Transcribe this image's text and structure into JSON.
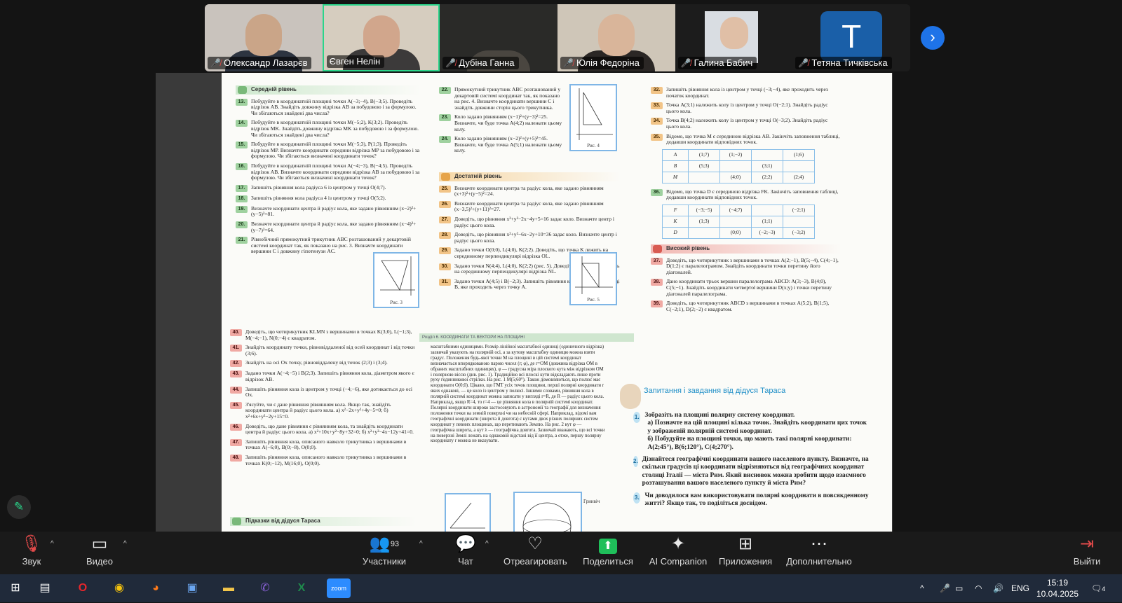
{
  "participants": [
    {
      "name": "Олександр Лазарєв",
      "muted": true
    },
    {
      "name": "Євген Нелін",
      "muted": false
    },
    {
      "name": "Дубіна Ганна",
      "muted": true
    },
    {
      "name": "Юлія Федоріна",
      "muted": true
    },
    {
      "name": "Галина Бабич",
      "muted": true
    },
    {
      "name": "Тетяна Тичківська",
      "muted": true,
      "initial": "T"
    }
  ],
  "doc": {
    "level_mid": "Середній рівень",
    "level_suff": "Достатній рівень",
    "level_high": "Високий рівень",
    "col1": [
      {
        "n": "13.",
        "t": "Побудуйте в координатній площині точки A(−3;−4), B(−3;5). Проведіть відрізок AB. Знайдіть довжину відрізка AB за побудовою і за формулою. Чи збігаються знайдені два числа?"
      },
      {
        "n": "14.",
        "t": "Побудуйте в координатній площині точки M(−5;2), K(3;2). Проведіть відрізок MK. Знайдіть довжину відрізка MK за побудовою і за формулою. Чи збігаються знайдені два числа?"
      },
      {
        "n": "15.",
        "t": "Побудуйте в координатній площині точки M(−5;3), P(1;3). Проведіть відрізок MP. Визначте координати середини відрізка MP за побудовою і за формулою. Чи збігаються визначені координати точок?"
      },
      {
        "n": "16.",
        "t": "Побудуйте в координатній площині точки A(−4;−3), B(−4;5). Проведіть відрізок AB. Визначте координати середини відрізка AB за побудовою і за формулою. Чи збігаються визначені координати точок?"
      },
      {
        "n": "17.",
        "t": "Запишіть рівняння кола радіуса 6 із центром у точці O(4;7)."
      },
      {
        "n": "18.",
        "t": "Запишіть рівняння кола радіуса 4 із центром у точці O(5;2)."
      },
      {
        "n": "19.",
        "t": "Визначте координати центра й радіус кола, яке задано рівнянням (x−2)²+(y−5)²=81."
      },
      {
        "n": "20.",
        "t": "Визначте координати центра й радіус кола, яке задано рівнянням (x−4)²+(y−7)²=64."
      },
      {
        "n": "21.",
        "t": "Рівнобічний прямокутний трикутник ABC розташований у декартовій системі координат так, як показано на рис. 3. Визначте координати вершини C і довжину гіпотенузи AC."
      }
    ],
    "col2": [
      {
        "n": "22.",
        "t": "Прямокутний трикутник ABC розташований у декартовій системі координат так, як показано на рис. 4. Визначте координати вершини C і знайдіть довжини сторін цього трикутника."
      },
      {
        "n": "23.",
        "t": "Коло задано рівнянням (x−1)²+(y−3)²=25. Визначте, чи буде точка A(4;2) належати цьому колу."
      },
      {
        "n": "24.",
        "t": "Коло задано рівнянням (x−2)²+(y+5)²=45. Визначте, чи буде точка A(5;1) належати цьому колу."
      }
    ],
    "col2b": [
      {
        "n": "25.",
        "t": "Визначте координати центра та радіус кола, яке задано рівнянням (x+3)²+(y−5)²=24."
      },
      {
        "n": "26.",
        "t": "Визначте координати центра та радіус кола, яке задано рівнянням (x−3,5)²+(y+11)²=27."
      },
      {
        "n": "27.",
        "t": "Доведіть, що рівняння x²+y²−2x−4y+5=16 задає коло. Визначте центр і радіус цього кола."
      },
      {
        "n": "28.",
        "t": "Доведіть, що рівняння x²+y²−6x−2y+10=36 задає коло. Визначте центр і радіус цього кола."
      },
      {
        "n": "29.",
        "t": "Задано точки O(0;0), L(4;0), K(2;2). Доведіть, що точка K лежить на серединному перпендикулярі відрізка OL."
      },
      {
        "n": "30.",
        "t": "Задано точки N(4;4), L(4;0), K(2;2) (рис. 5). Доведіть, що точка K лежить на серединному перпендикулярі відрізка NL."
      },
      {
        "n": "31.",
        "t": "Задано точки A(4;5) і B(−2;3). Запишіть рівняння кола із центром у точці B, яке проходить через точку A."
      }
    ],
    "col3": [
      {
        "n": "32.",
        "t": "Запишіть рівняння кола із центром у точці (−3;−4), яке проходить через початок координат."
      },
      {
        "n": "33.",
        "t": "Точка A(3;1) належить колу із центром у точці O(−2;1). Знайдіть радіус цього кола."
      },
      {
        "n": "34.",
        "t": "Точка B(4;2) належить колу із центром у точці O(−3;2). Знайдіть радіус цього кола."
      },
      {
        "n": "35.",
        "t": "Відомо, що точка M є серединою відрізка AB. Закінчіть заповнення таблиці, додавши координати відповідних точок."
      }
    ],
    "table35": [
      [
        "A",
        "(1;7)",
        "(1;−2)",
        "",
        "(1;6)"
      ],
      [
        "B",
        "(5;3)",
        "",
        "(3;1)",
        ""
      ],
      [
        "M",
        "",
        "(4;0)",
        "(2;2)",
        "(2;4)"
      ]
    ],
    "task36": {
      "n": "36.",
      "t": "Відомо, що точка D є серединою відрізка FK. Закінчіть заповнення таблиці, додавши координати відповідних точок."
    },
    "table36": [
      [
        "F",
        "(−3;−5)",
        "(−4;7)",
        "",
        "(−2;1)"
      ],
      [
        "K",
        "(1;3)",
        "",
        "(1;1)",
        ""
      ],
      [
        "D",
        "",
        "(0;0)",
        "(−2;−3)",
        "(−3;2)"
      ]
    ],
    "col3b": [
      {
        "n": "37.",
        "t": "Доведіть, що чотирикутник з вершинами в точках A(2;−1), B(5;−4), C(4;−1), D(1;2) є паралелограмом. Знайдіть координати точки перетину його діагоналей."
      },
      {
        "n": "38.",
        "t": "Дано координати трьох вершин паралелограма ABCD: A(3;−3), B(4;0), C(5;−1). Знайдіть координати четвертої вершини D(x;y) і точки перетину діагоналей паралелограма."
      },
      {
        "n": "39.",
        "t": "Доведіть, що чотирикутник ABCD з вершинами в точках A(5;2), B(1;5), C(−2;1), D(2;−2) є квадратом."
      }
    ],
    "col4": [
      {
        "n": "40.",
        "t": "Доведіть, що чотирикутник KLMN з вершинами в точках K(3;0), L(−1;3), M(−4;−1), N(0;−4) є квадратом."
      },
      {
        "n": "41.",
        "t": "Знайдіть координату точки, рівновіддаленої від осей координат і від точки (3;6)."
      },
      {
        "n": "42.",
        "t": "Знайдіть на осі Ox точку, рівновіддалену від точок (2;3) і (3;4)."
      },
      {
        "n": "43.",
        "t": "Задано точки A(−4;−5) і B(2;3). Запишіть рівняння кола, діаметром якого є відрізок AB."
      },
      {
        "n": "44.",
        "t": "Запишіть рівняння кола із центром у точці (−4;−6), яке дотикається до осі Ox."
      },
      {
        "n": "45.",
        "t": "З'ясуйте, чи є дане рівняння рівнянням кола. Якщо так, знайдіть координати центра й радіус цього кола. а) x²−2x+y²+4y−5=0; б) x²+6x+y²−2y+15=0."
      },
      {
        "n": "46.",
        "t": "Доведіть, що дане рівняння є рівнянням кола, та знайдіть координати центра й радіус цього кола. а) x²+10x+y²−8y+32=0; б) x²+y²−4x−12y+41=0."
      },
      {
        "n": "47.",
        "t": "Запишіть рівняння кола, описаного навколо трикутника з вершинами в точках A(−6;0), B(0;−8), O(0;0)."
      },
      {
        "n": "48.",
        "t": "Запишіть рівняння кола, описаного навколо трикутника з вершинами в точках K(0;−12), M(16;0), O(0;0)."
      }
    ],
    "hint_band": "Підказки від дідуся Тараса",
    "section_band": "Розділ 6. КООРДИНАТИ ТА ВЕКТОРИ НА ПЛОЩИНІ",
    "polar_text": "масштабними одиницями. Розмір лінійної масштабної одиниці (одиничного відрізка) зазвичай указують на полярній осі, а за кутову масштабну одиницю можна взяти градус. Положення будь-якої точки M на площині в цій системі координат визначається впорядкованою парою чисел (r; φ), де r=OM (довжина відрізка OM в обраних масштабних одиницях), φ — градусна міра плоского кута між відрізком OM і полярною віссю (див. рис. 1). Традиційно всі плоскі кути відкладають лише проти руху годинникової стрілки. На рис. 1 M(5;60°). Також домовляються, що полюс має координати O(0;0). Цікаво, що ГМТ усіх точок площини, перші полярні координати r яких однакові, — це коло із центром у полюсі. Іншими словами, рівняння кола в полярній системі координат можна записати у вигляді r=R, де R — радіус цього кола. Наприклад, якщо R=4, то r=4 — це рівняння кола в полярній системі координат. Полярні координати широко застосовують в астрономії та географії для визначення положення точки на земній поверхні чи на небесній сфері. Наприклад, відомі вам географічні координати (широта й довгота) є кутами двох різних полярних систем координат у певних площинах, що перетинають Землю. На рис. 2 кут φ — географічна широта, а кут λ — географічна довгота. Зазвичай вважають, що всі точки на поверхні Землі лежать на однаковій відстані від її центра, а отже, першу полярну координату r можна не вказувати.",
    "fig_labels": {
      "fig3": "Рис. 3",
      "fig4": "Рис. 4",
      "fig5": "Рис. 5",
      "greenwich": "Гринвіч"
    },
    "questions_title": "Запитання і завдання від дідуся Тараса",
    "questions": [
      {
        "n": "1.",
        "t": "Зобразіть на площині полярну систему координат.",
        "sub": [
          "а) Позначте на цій площині кілька точок. Знайдіть координати цих точок у зображеній полярній системі координат.",
          "б) Побудуйте на площині точки, що мають такі полярні координати: A(2;45°), B(6;120°), C(4;270°)."
        ]
      },
      {
        "n": "2.",
        "t": "Дізнайтеся географічні координати вашого населеного пункту. Визначте, на скільки градусів ці координати відрізняються від географічних координат столиці Італії — міста Рим. Який висновок можна зробити щодо взаємного розташування вашого населеного пункту й міста Рим?",
        "sub": []
      },
      {
        "n": "3.",
        "t": "Чи доводилося вам використовувати полярні координати в повсякденному житті? Якщо так, то поділіться досвідом.",
        "sub": []
      }
    ]
  },
  "toolbar": {
    "audio": "Звук",
    "video": "Видео",
    "participants": "Участники",
    "participants_count": "93",
    "chat": "Чат",
    "react": "Отреагировать",
    "share": "Поделиться",
    "ai": "AI Companion",
    "apps": "Приложения",
    "more": "Дополнительно",
    "leave": "Выйти"
  },
  "taskbar": {
    "lang": "ENG",
    "time": "15:19",
    "date": "10.04.2025",
    "notif_count": "4"
  }
}
